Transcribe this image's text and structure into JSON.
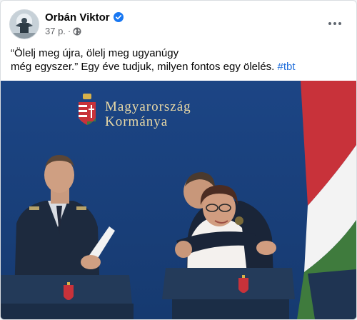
{
  "post": {
    "author": "Orbán Viktor",
    "time": "37 p.",
    "separator": "·",
    "caption_line1": "“Ölelj meg újra, ölelj meg ugyanúgy",
    "caption_line2": "még egyszer.” Egy éve tudjuk, milyen fontos egy ölelés.",
    "hashtag": "#tbt",
    "icons": [
      "verified-badge-icon",
      "globe-icon",
      "more-options-icon"
    ]
  },
  "photo": {
    "backdrop_line1": "Magyarország",
    "backdrop_line2": "Kormánya"
  },
  "colors": {
    "accent": "#216fdb",
    "verified": "#1877f2",
    "backdrop": "#1f4b8f",
    "flag_red": "#c8323a",
    "flag_green": "#3f7b3d"
  }
}
